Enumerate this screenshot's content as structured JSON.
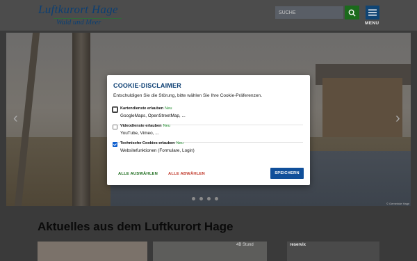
{
  "header": {
    "logo_main": "Luftkurort Hage",
    "logo_sub": "Wald und Meer",
    "search_placeholder": "SUCHE",
    "menu_label": "MENU"
  },
  "slider": {
    "prev_icon": "chevron-left-icon",
    "next_icon": "chevron-right-icon",
    "credit": "© Gemeinde Hage"
  },
  "news": {
    "title": "Aktuelles aus dem Luftkurort Hage",
    "card2_text": "4B Stund",
    "card3_text": "reservix"
  },
  "cookie": {
    "title": "COOKIE-DISCLAIMER",
    "subtitle": "Entschuldigen Sie die Störung, bitte wählen Sie Ihre Cookie-Präferenzen.",
    "options": [
      {
        "label": "Kartendienste erlauben",
        "badge": "Neu",
        "desc": "GoogleMaps, OpenStreetMap, ...",
        "checked": false
      },
      {
        "label": "Videodienste erlauben",
        "badge": "Neu",
        "desc": "YouTube, Vimeo, ...",
        "checked": false
      },
      {
        "label": "Technische Cookies erlauben",
        "badge": "Neu",
        "desc": "Websitefunktionen (Formulare, Login)",
        "checked": true
      }
    ],
    "btn_allow_all": "ALLE AUSWÄHLEN",
    "btn_deny_all": "ALLE ABWÄHLEN",
    "btn_save": "SPEICHERN"
  },
  "colors": {
    "brand_blue": "#0c3f73",
    "search_green": "#1b6a1c",
    "save_blue": "#104f9a",
    "deny_red": "#c0392b",
    "new_green": "#1b8a2a"
  }
}
